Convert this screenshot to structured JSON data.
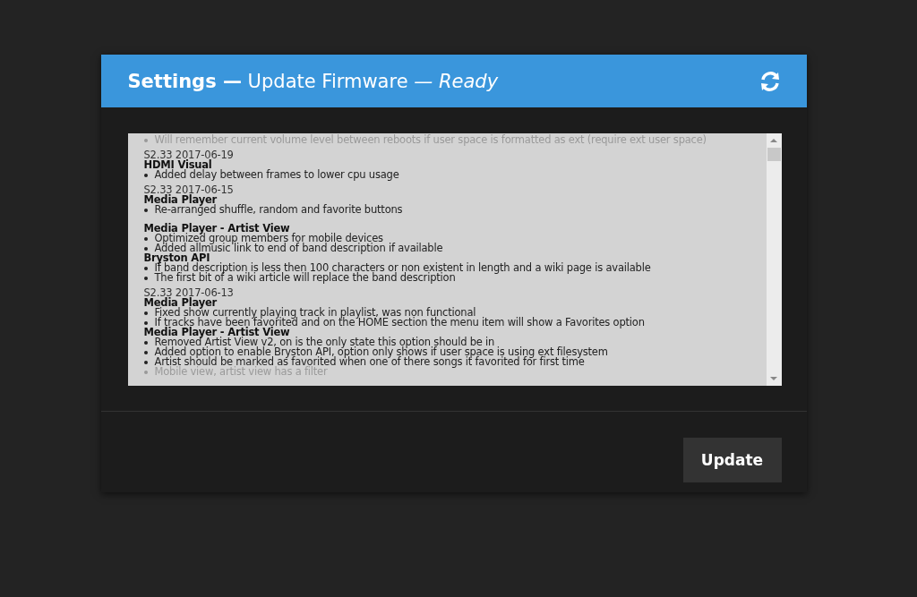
{
  "dialog": {
    "title": "**Settings —** Update Firmware *— Ready*",
    "changelog": [
      {
        "kind": "item",
        "text": "Will remember current volume level between reboots if user space is formatted as ext (require ext user space)",
        "faded": true
      },
      {
        "kind": "version",
        "text": "S2.33 2017-06-19"
      },
      {
        "kind": "heading",
        "text": "HDMI Visual"
      },
      {
        "kind": "item",
        "text": "Added delay between frames to lower cpu usage",
        "faded": false
      },
      {
        "kind": "version",
        "text": "S2.33 2017-06-15"
      },
      {
        "kind": "heading",
        "text": "Media Player"
      },
      {
        "kind": "item",
        "text": "Re-arranged shuffle, random and favorite buttons",
        "faded": false
      },
      {
        "kind": "gap"
      },
      {
        "kind": "heading",
        "text": "Media Player - Artist View"
      },
      {
        "kind": "item",
        "text": "Optimized group members for mobile devices",
        "faded": false
      },
      {
        "kind": "item",
        "text": "Added allmusic link to end of band description if available",
        "faded": false
      },
      {
        "kind": "heading",
        "text": "Bryston API"
      },
      {
        "kind": "item",
        "text": "If band description is less then 100 characters or non existent in length and a wiki page is available",
        "faded": false
      },
      {
        "kind": "item",
        "text": "The first bit of a wiki article will replace the band description",
        "faded": false
      },
      {
        "kind": "version",
        "text": "S2.33 2017-06-13"
      },
      {
        "kind": "heading",
        "text": "Media Player"
      },
      {
        "kind": "item",
        "text": "Fixed show currently playing track in playlist, was non functional",
        "faded": false
      },
      {
        "kind": "item",
        "text": "If tracks have been favorited and on the HOME section the menu item will show a Favorites option",
        "faded": false
      },
      {
        "kind": "heading",
        "text": "Media Player - Artist View"
      },
      {
        "kind": "item",
        "text": "Removed Artist View v2, on is the only state this option should be in",
        "faded": false
      },
      {
        "kind": "item",
        "text": "Added option to enable Bryston API, option only shows if user space is using ext filesystem",
        "faded": false
      },
      {
        "kind": "item",
        "text": "Artist should be marked as favorited when one of there songs it favorited for first time",
        "faded": false
      },
      {
        "kind": "item",
        "text": "Mobile view, artist view has a filter",
        "faded": true
      }
    ],
    "button": "Update"
  }
}
